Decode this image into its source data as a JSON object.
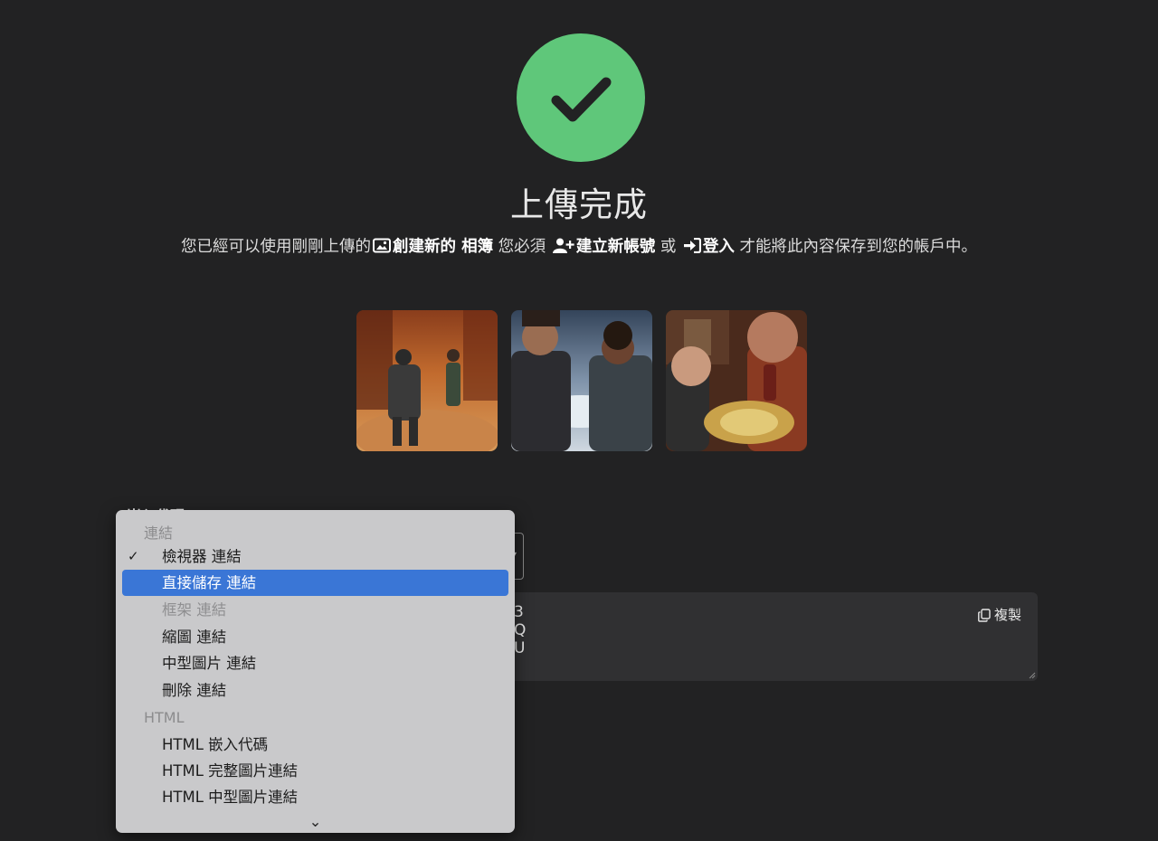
{
  "header": {
    "title": "上傳完成",
    "message": {
      "prefix": "您已經可以使用剛剛上傳的",
      "create_link": "創建新的 相簿",
      "middle": "您必須",
      "signup_link": "建立新帳號",
      "or": "或",
      "login_link": "登入",
      "suffix": "才能將此內容保存到您的帳戶中。"
    }
  },
  "thumbnails": [
    {
      "alt": "uploaded-image-1"
    },
    {
      "alt": "uploaded-image-2"
    },
    {
      "alt": "uploaded-image-3"
    }
  ],
  "embed": {
    "label": "嵌入代碼",
    "code_fragments": [
      "3",
      "Q",
      "U"
    ],
    "copy_label": "複製"
  },
  "menu": {
    "group_links": "連結",
    "items_links": [
      {
        "label": "檢視器 連結",
        "checked": true
      },
      {
        "label": "直接儲存 連結",
        "selected": true
      },
      {
        "label": "框架 連結",
        "disabled": true
      },
      {
        "label": "縮圖 連結"
      },
      {
        "label": "中型圖片 連結"
      },
      {
        "label": "刪除 連結"
      }
    ],
    "group_html": "HTML",
    "items_html": [
      {
        "label": "HTML 嵌入代碼"
      },
      {
        "label": "HTML 完整圖片連結"
      },
      {
        "label": "HTML 中型圖片連結"
      }
    ],
    "check_mark": "✓",
    "more_indicator": "⌄"
  },
  "colors": {
    "background": "#222223",
    "success": "#5fc77a",
    "menu_bg": "#c9c9cb",
    "menu_selected": "#3a76d6"
  },
  "icons": {
    "create_album": "image-icon",
    "signup": "user-plus-icon",
    "login": "sign-in-icon",
    "copy": "copy-icon",
    "status": "check-icon"
  }
}
